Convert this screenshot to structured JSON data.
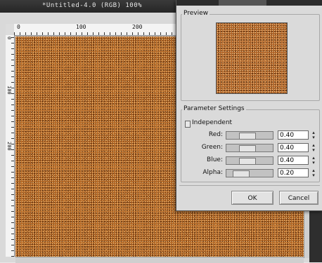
{
  "image_window": {
    "title": "*Untitled-4.0 (RGB) 100%",
    "ruler_top_labels": [
      "0",
      "100",
      "200"
    ],
    "ruler_left_labels": [
      "0",
      "100",
      "200"
    ]
  },
  "dialog": {
    "preview_label": "Preview",
    "parameters_label": "Parameter Settings",
    "independent_label": "Independent",
    "independent_checked": false,
    "params": [
      {
        "label": "Red:",
        "value": "0.40",
        "level": 0.4
      },
      {
        "label": "Green:",
        "value": "0.40",
        "level": 0.4
      },
      {
        "label": "Blue:",
        "value": "0.40",
        "level": 0.4
      },
      {
        "label": "Alpha:",
        "value": "0.20",
        "level": 0.2
      }
    ],
    "ok_label": "OK",
    "cancel_label": "Cancel"
  },
  "colors": {
    "noise_base": "#b86a26",
    "titlebar": "#2c2c2c"
  }
}
